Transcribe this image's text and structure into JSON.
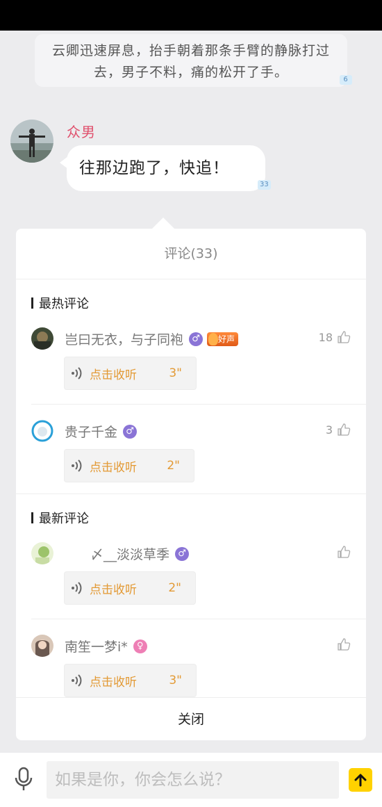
{
  "story": {
    "narration": "云卿迅速屏息，抬手朝着那条手臂的静脉打过去，男子不料，痛的松开了手。",
    "narration_count": "6",
    "speaker_name": "众男",
    "speaker_line": "往那边跑了，快追！",
    "speaker_count": "33"
  },
  "panel": {
    "title": "评论(33)",
    "hot_section": "最热评论",
    "new_section": "最新评论",
    "close_label": "关闭"
  },
  "comments": [
    {
      "name": "岂曰无衣，与子同袍",
      "gender": "♂",
      "badge": "好声",
      "likes": "18",
      "audio_label": "点击收听",
      "duration": "3\""
    },
    {
      "name": "贵子千金",
      "gender": "♂",
      "likes": "3",
      "audio_label": "点击收听",
      "duration": "2\""
    },
    {
      "name": "〆__淡淡草季",
      "gender": "♂",
      "likes": "",
      "audio_label": "点击收听",
      "duration": "2\""
    },
    {
      "name": "南笙一梦i*",
      "gender": "♀",
      "likes": "",
      "audio_label": "点击收听",
      "duration": "3\""
    }
  ],
  "input": {
    "placeholder": "如果是你，你会怎么说？"
  },
  "colors": {
    "accent_yellow": "#ffd200",
    "audio_orange": "#e39a35",
    "speaker_pink": "#e0506c",
    "male_purple": "#8a74d6",
    "female_pink": "#ee7fb5"
  },
  "icons": [
    "mic-icon",
    "send-arrow-icon",
    "thumb-up-icon",
    "audio-wave-icon",
    "male-icon",
    "female-icon"
  ]
}
